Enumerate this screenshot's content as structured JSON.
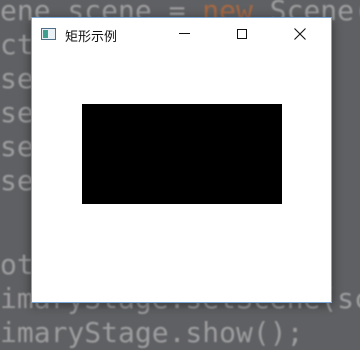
{
  "background_code": {
    "lines": [
      {
        "pre": "ene scene = ",
        "kw": "new",
        "post": " Scene("
      },
      {
        "pre": "ct",
        "kw": "",
        "post": ""
      },
      {
        "pre": "se",
        "kw": "",
        "post": ""
      },
      {
        "pre": "se",
        "kw": "",
        "post": ""
      },
      {
        "pre": "se",
        "kw": "",
        "post": ""
      },
      {
        "pre": "se",
        "kw": "",
        "post": ""
      },
      {
        "pre": "",
        "kw": "",
        "post": ""
      },
      {
        "pre": "ot",
        "kw": "",
        "post": ""
      },
      {
        "pre": "imaryStage.setScene(sc",
        "kw": "",
        "post": ""
      },
      {
        "pre": "imaryStage.show();",
        "kw": "",
        "post": ""
      }
    ]
  },
  "window": {
    "title": "矩形示例",
    "rect_color": "#000000"
  },
  "colors": {
    "keyword": "#e0702a",
    "window_border": "#7aa7d6"
  }
}
